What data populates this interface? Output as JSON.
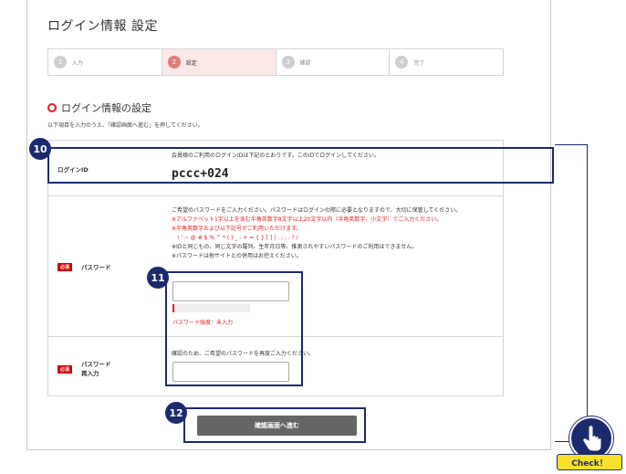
{
  "page": {
    "title": "ログイン情報 設定"
  },
  "steps": [
    {
      "num": "1",
      "label": "入力"
    },
    {
      "num": "2",
      "label": "設定"
    },
    {
      "num": "3",
      "label": "確認"
    },
    {
      "num": "4",
      "label": "完了"
    }
  ],
  "section": {
    "title": "ログイン情報の設定",
    "description": "以下項目を入力のうえ、「確認画面へ進む」を押してください。"
  },
  "login_row": {
    "label": "ログインID",
    "note": "会員様のご利用のログインIDは下記のとおりです。このIDでログインしてください。",
    "value": "pccc+024"
  },
  "password_row": {
    "required": "必須",
    "label": "パスワード",
    "note1": "ご希望のパスワードをご入力ください。パスワードはログインの際に必要となりますので、大切に保管してください。",
    "rule1": "※アルファベット1字以上を含む半角英数字8文字以上20文字以内（半角英数字、小文字）でご入力ください。",
    "rule2": "※半角英数字および以下記号がご利用いただけます。",
    "symbols": "! ' ~ @ # $ % ^ * ( ) _ - + = { } [ ] | : ; , . ? /",
    "note2": "※IDと同じもの、同じ文字の羅列、生年月日等、推測されやすいパスワードのご利用はできません。",
    "note3": "※パスワードは他サイトとの併用はお控えください。",
    "strength": "パスワード強度：未入力"
  },
  "password_confirm_row": {
    "required": "必須",
    "label_line1": "パスワード",
    "label_line2": "再入力",
    "note": "確認のため、ご希望のパスワードを再度ご入力ください。"
  },
  "submit": {
    "label": "確認画面へ進む"
  },
  "callouts": {
    "c10": "10",
    "c11": "11",
    "c12": "12",
    "check_label": "Check！"
  },
  "colors": {
    "accent_red": "#e02020",
    "navy": "#1b2a6e",
    "check_yellow": "#f7e12a"
  }
}
